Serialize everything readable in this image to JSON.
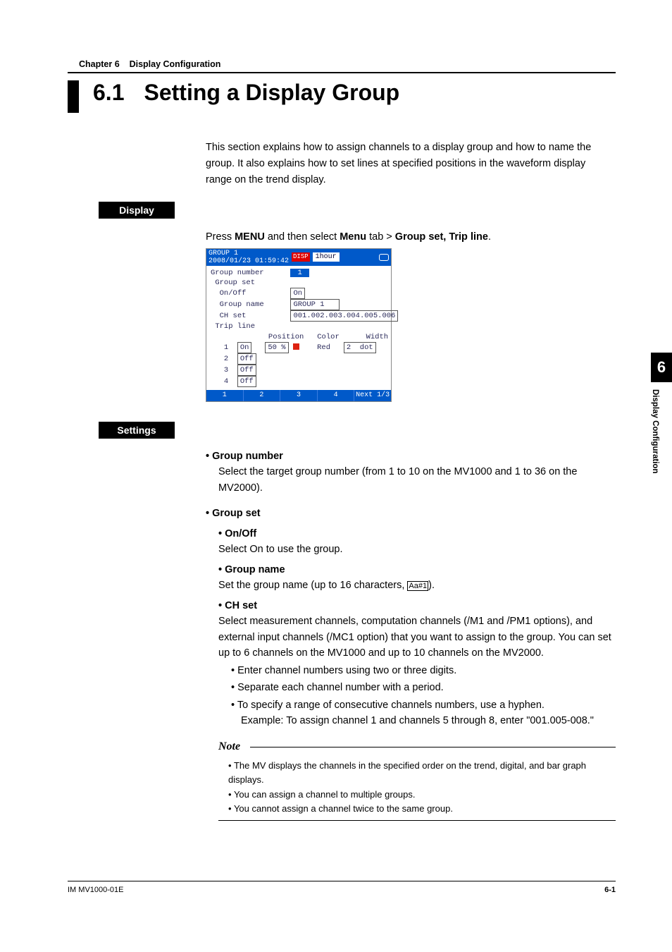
{
  "header": {
    "chapter_label": "Chapter 6",
    "chapter_title": "Display Configuration"
  },
  "title": {
    "number": "6.1",
    "text": "Setting a Display Group"
  },
  "intro": "This section explains how to assign channels to a display group and how to name the group. It also explains how to set lines at specified positions in the waveform display range on the trend display.",
  "display": {
    "label": "Display",
    "instruction_pre": "Press ",
    "instruction_b1": "MENU",
    "instruction_mid": " and then select ",
    "instruction_b2": "Menu",
    "instruction_mid2": " tab > ",
    "instruction_b3": "Group set, Trip line",
    "instruction_post": "."
  },
  "screenshot": {
    "title_line1": "GROUP 1",
    "title_line2": "2008/01/23 01:59:42",
    "icon_txt": "DISP",
    "time_btn": "1hour",
    "rows": {
      "group_number_lbl": "Group number",
      "group_number_val": "1",
      "group_set_lbl": "Group set",
      "onoff_lbl": "On/Off",
      "onoff_val": "On",
      "gname_lbl": "Group name",
      "gname_val": "GROUP 1",
      "chset_lbl": "CH set",
      "chset_val": "001.002.003.004.005.006",
      "tripline_lbl": "Trip line",
      "hdr_pos": "Position",
      "hdr_color": "Color",
      "hdr_width": "Width",
      "r1_n": "1",
      "r1_on": "On",
      "r1_pos": "50 %",
      "r1_col": "Red",
      "r1_w": "2  dot",
      "r2_n": "2",
      "r2_on": "Off",
      "r3_n": "3",
      "r3_on": "Off",
      "r4_n": "4",
      "r4_on": "Off"
    },
    "foot": {
      "b1": "1",
      "b2": "2",
      "b3": "3",
      "b4": "4",
      "next": "Next 1/3"
    }
  },
  "settings": {
    "label": "Settings",
    "items": {
      "gn_h": "Group number",
      "gn_b": "Select the target group number (from 1 to 10 on the MV1000 and 1 to 36 on the MV2000).",
      "gs_h": "Group set",
      "onoff_h": "On/Off",
      "onoff_b": "Select On to use the group.",
      "gname_h": "Group name",
      "gname_b1": "Set the group name (up to 16 characters, ",
      "gname_sym": "Aa#1",
      "gname_b2": ").",
      "ch_h": "CH set",
      "ch_b": "Select measurement channels, computation channels (/M1 and /PM1 options), and external input channels (/MC1 option) that you want to assign to the group. You can set up to 6 channels on the MV1000 and up to 10 channels on the MV2000.",
      "ch_l1": "Enter channel numbers using two or three digits.",
      "ch_l2": "Separate each channel number with a period.",
      "ch_l3a": "To specify a range of consecutive channels numbers, use a hyphen.",
      "ch_l3b": "Example: To assign channel 1 and channels 5 through 8, enter \"001.005-008.\""
    },
    "note": {
      "title": "Note",
      "n1": "The MV displays the channels in the specified order on the trend, digital, and bar graph displays.",
      "n2": "You can assign a channel to multiple groups.",
      "n3": "You cannot assign a channel twice to the same group."
    }
  },
  "sidetab": {
    "num": "6",
    "text": "Display Configuration"
  },
  "footer": {
    "left": "IM MV1000-01E",
    "right": "6-1"
  }
}
